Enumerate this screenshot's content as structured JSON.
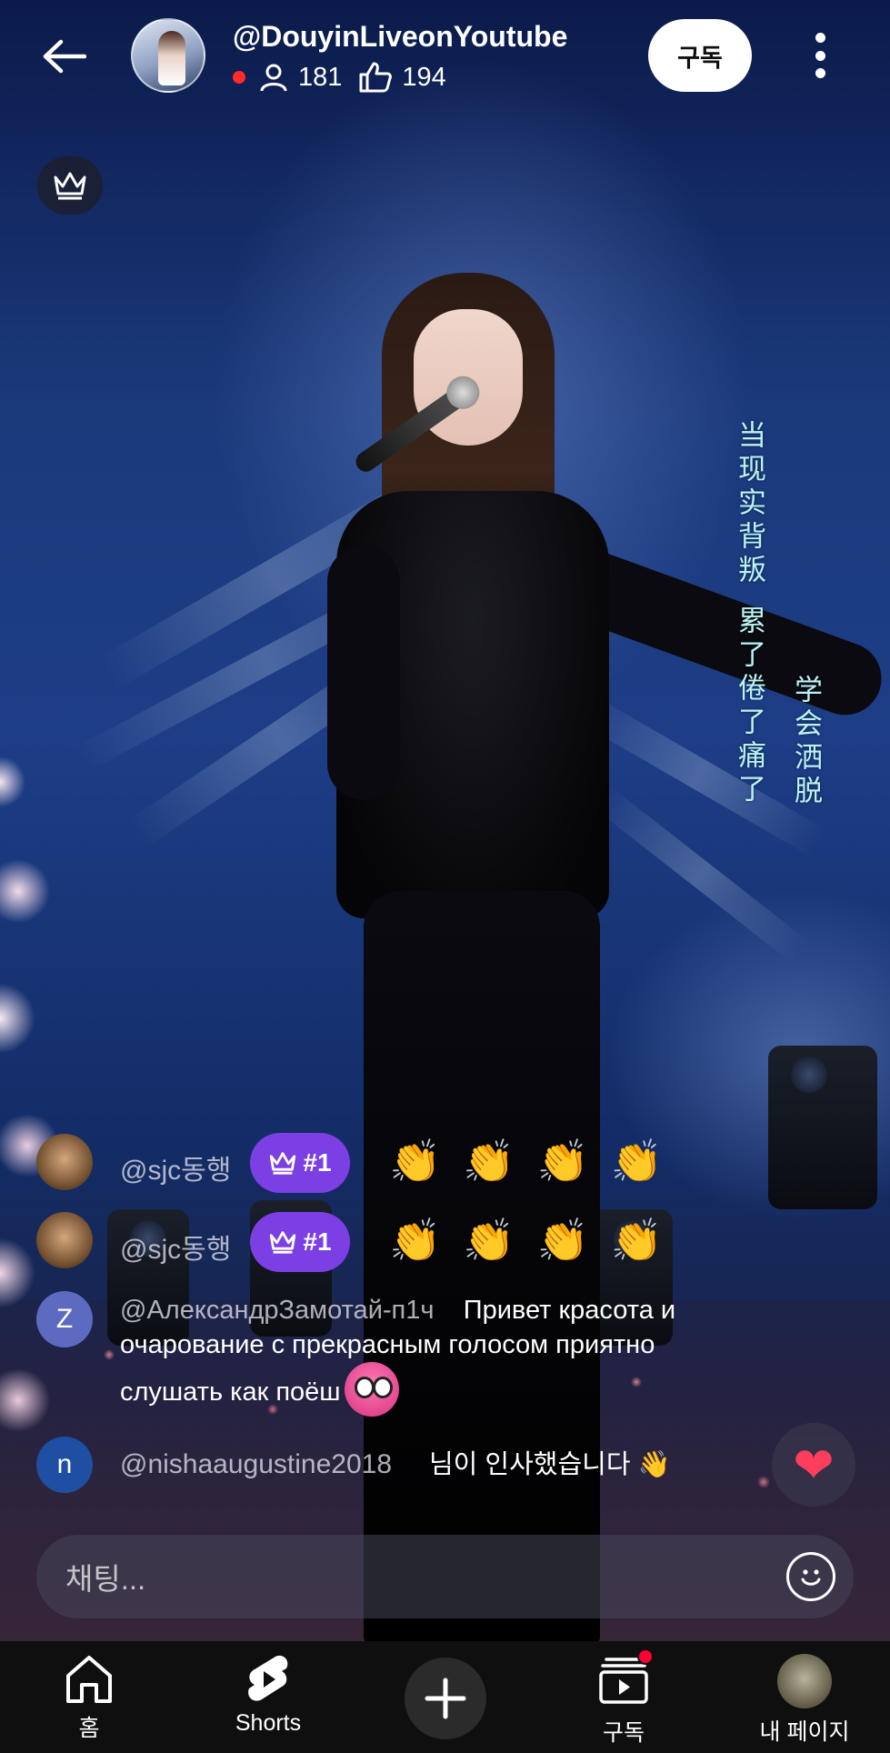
{
  "header": {
    "channel_name": "@DouyinLiveonYoutube",
    "viewers": "181",
    "likes": "194",
    "subscribe_label": "구독"
  },
  "lyrics": {
    "col1": "当现实背叛",
    "col2": "累了倦了痛了",
    "col3": "学会洒脱"
  },
  "chat": {
    "messages": [
      {
        "author": "@sjc동행",
        "rank": "#1",
        "text": "👏👏👏👏"
      },
      {
        "author": "@sjc동행",
        "rank": "#1",
        "text": "👏👏👏👏"
      },
      {
        "avatar_letter": "Z",
        "author": "@АлександрЗамотай-п1ч",
        "text_line1": "Привет красота и",
        "text_line2": "очарование с прекрасным голосом приятно",
        "text_line3": "слушать как поёш"
      },
      {
        "avatar_letter": "n",
        "author": "@nishaaugustine2018",
        "text": "님이 인사했습니다 👋"
      }
    ],
    "input_placeholder": "채팅..."
  },
  "bottom_nav": {
    "items": [
      {
        "label": "홈",
        "icon": "home-icon"
      },
      {
        "label": "Shorts",
        "icon": "shorts-icon"
      },
      {
        "label": "",
        "icon": "plus-icon"
      },
      {
        "label": "구독",
        "icon": "subscriptions-icon"
      },
      {
        "label": "내 페이지",
        "icon": "avatar"
      }
    ]
  },
  "colors": {
    "rank_badge": "#7b3fe4",
    "live_dot": "#ff2a2a",
    "heart": "#ff3d5c",
    "notification_dot": "#ff0033",
    "lyrics": "#b9f3f6"
  }
}
